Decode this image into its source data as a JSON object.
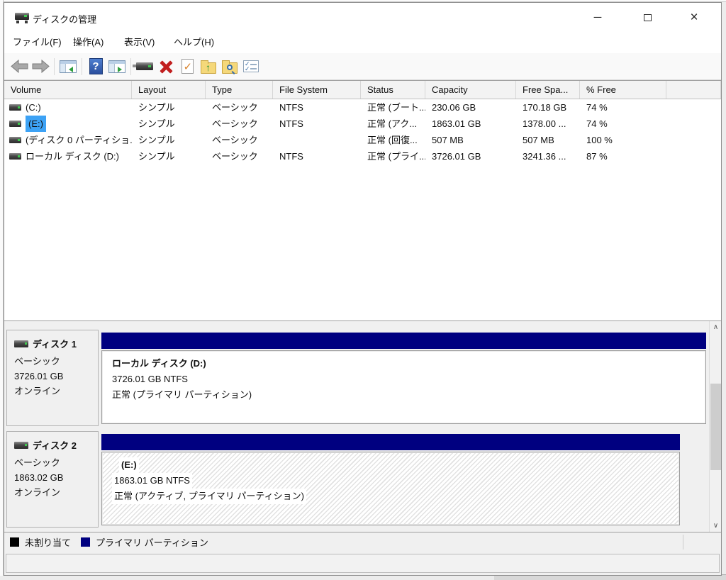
{
  "window": {
    "title": "ディスクの管理",
    "controls": {
      "minimize": "─",
      "maximize": "",
      "close": "×"
    }
  },
  "menu": {
    "items": [
      "ファイル(F)",
      "操作(A)",
      "表示(V)",
      "ヘルプ(H)"
    ]
  },
  "toolbar": {
    "icons": [
      "back",
      "forward",
      "show-console-tree",
      "help",
      "show-action-pane",
      "device-properties",
      "delete-volume",
      "mark-partition-active",
      "open-folder",
      "explore-folder",
      "properties-list"
    ],
    "help_glyph": "?",
    "check_glyph": "✓",
    "up_glyph": "↑",
    "check_small": "✓"
  },
  "volume_list": {
    "columns": [
      "Volume",
      "Layout",
      "Type",
      "File System",
      "Status",
      "Capacity",
      "Free Spa...",
      "% Free"
    ],
    "rows": [
      {
        "volume": "(C:)",
        "layout": "シンプル",
        "type": "ベーシック",
        "fs": "NTFS",
        "status": "正常 (ブート...",
        "capacity": "230.06 GB",
        "free": "170.18 GB",
        "pct": "74 %"
      },
      {
        "volume": "(E:)",
        "layout": "シンプル",
        "type": "ベーシック",
        "fs": "NTFS",
        "status": "正常 (アク...",
        "capacity": "1863.01 GB",
        "free": "1378.00 ...",
        "pct": "74 %"
      },
      {
        "volume": "(ディスク 0 パーティショ...",
        "layout": "シンプル",
        "type": "ベーシック",
        "fs": "",
        "status": "正常 (回復...",
        "capacity": "507 MB",
        "free": "507 MB",
        "pct": "100 %"
      },
      {
        "volume": "ローカル ディスク (D:)",
        "layout": "シンプル",
        "type": "ベーシック",
        "fs": "NTFS",
        "status": "正常 (プライ...",
        "capacity": "3726.01 GB",
        "free": "3241.36 ...",
        "pct": "87 %"
      }
    ],
    "selected_row": "(E:)"
  },
  "disks": [
    {
      "name": "ディスク 1",
      "kind": "ベーシック",
      "size": "3726.01 GB",
      "status": "オンライン",
      "partition": {
        "label": "ローカル ディスク  (D:)",
        "detail": "3726.01 GB NTFS",
        "status": "正常 (プライマリ パーティション)",
        "selected": false
      }
    },
    {
      "name": "ディスク 2",
      "kind": "ベーシック",
      "size": "1863.02 GB",
      "status": "オンライン",
      "partition": {
        "label": "(E:)",
        "detail": "1863.01 GB NTFS",
        "status": "正常 (アクティブ, プライマリ パーティション)",
        "selected": true
      }
    }
  ],
  "legend": {
    "items": [
      {
        "label": "未割り当て",
        "color": "#000000"
      },
      {
        "label": "プライマリ パーティション",
        "color": "#000080"
      }
    ]
  },
  "scrollbar": {
    "up": "∧",
    "down": "∨"
  },
  "colors": {
    "partition_primary": "#000080",
    "selection": "#3da2f5",
    "unallocated": "#000000"
  }
}
